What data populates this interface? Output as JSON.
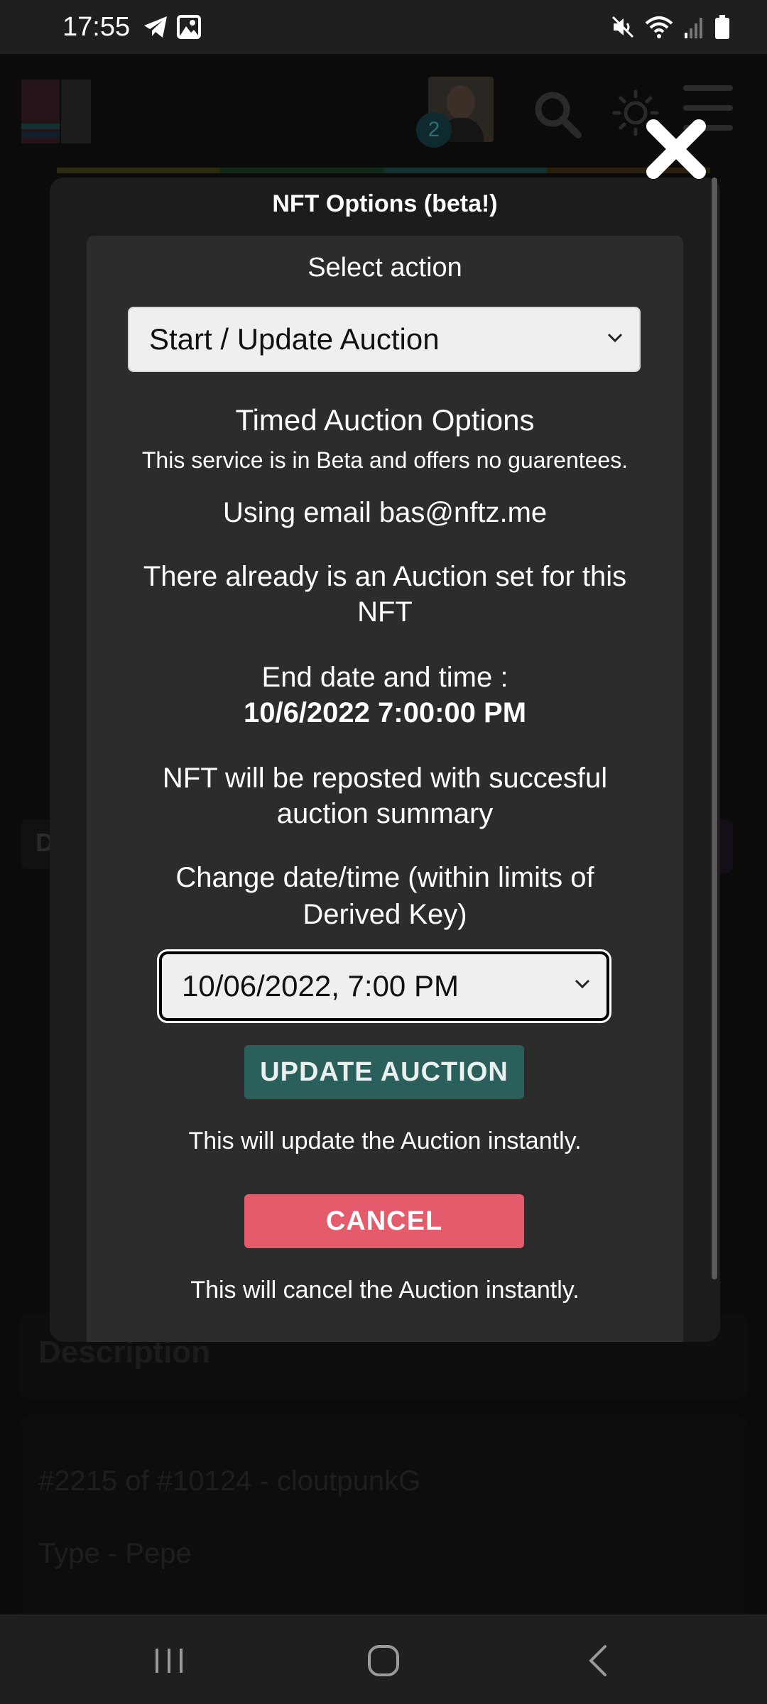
{
  "status_bar": {
    "time": "17:55",
    "left_icons": [
      "telegram-icon",
      "gallery-icon"
    ],
    "right_icons": [
      "mute-icon",
      "wifi-icon",
      "signal-icon",
      "battery-icon"
    ]
  },
  "background": {
    "notification_count": "2",
    "partial_tab_label": "D",
    "description_heading": "Description",
    "info_lines": [
      "#2215 of #10124 - cloutpunkG",
      "Type - Pepe"
    ]
  },
  "modal": {
    "title": "NFT Options (beta!)",
    "select_action_label": "Select action",
    "action_selected": "Start / Update Auction",
    "section_heading": "Timed Auction Options",
    "beta_notice": "This service is in Beta and offers no guarentees.",
    "email_text": "Using email bas@nftz.me",
    "existing_line1": "There already is an Auction set for this",
    "existing_line2": "NFT",
    "end_label": "End date and time :",
    "end_value": "10/6/2022 7:00:00 PM",
    "repost_line1": "NFT will be reposted with succesful",
    "repost_line2": "auction summary",
    "change_line1": "Change date/time (within limits of",
    "change_line2": "Derived Key)",
    "datetime_value": "10/06/2022, 7:00 PM",
    "update_button": "UPDATE AUCTION",
    "update_note": "This will update the Auction instantly.",
    "cancel_button": "CANCEL",
    "cancel_note": "This will cancel the Auction instantly."
  },
  "colors": {
    "update_button": "#2b5f5b",
    "cancel_button": "#e45b6c",
    "modal_bg": "#1c1c1c",
    "inner_bg": "#2c2c2c"
  }
}
